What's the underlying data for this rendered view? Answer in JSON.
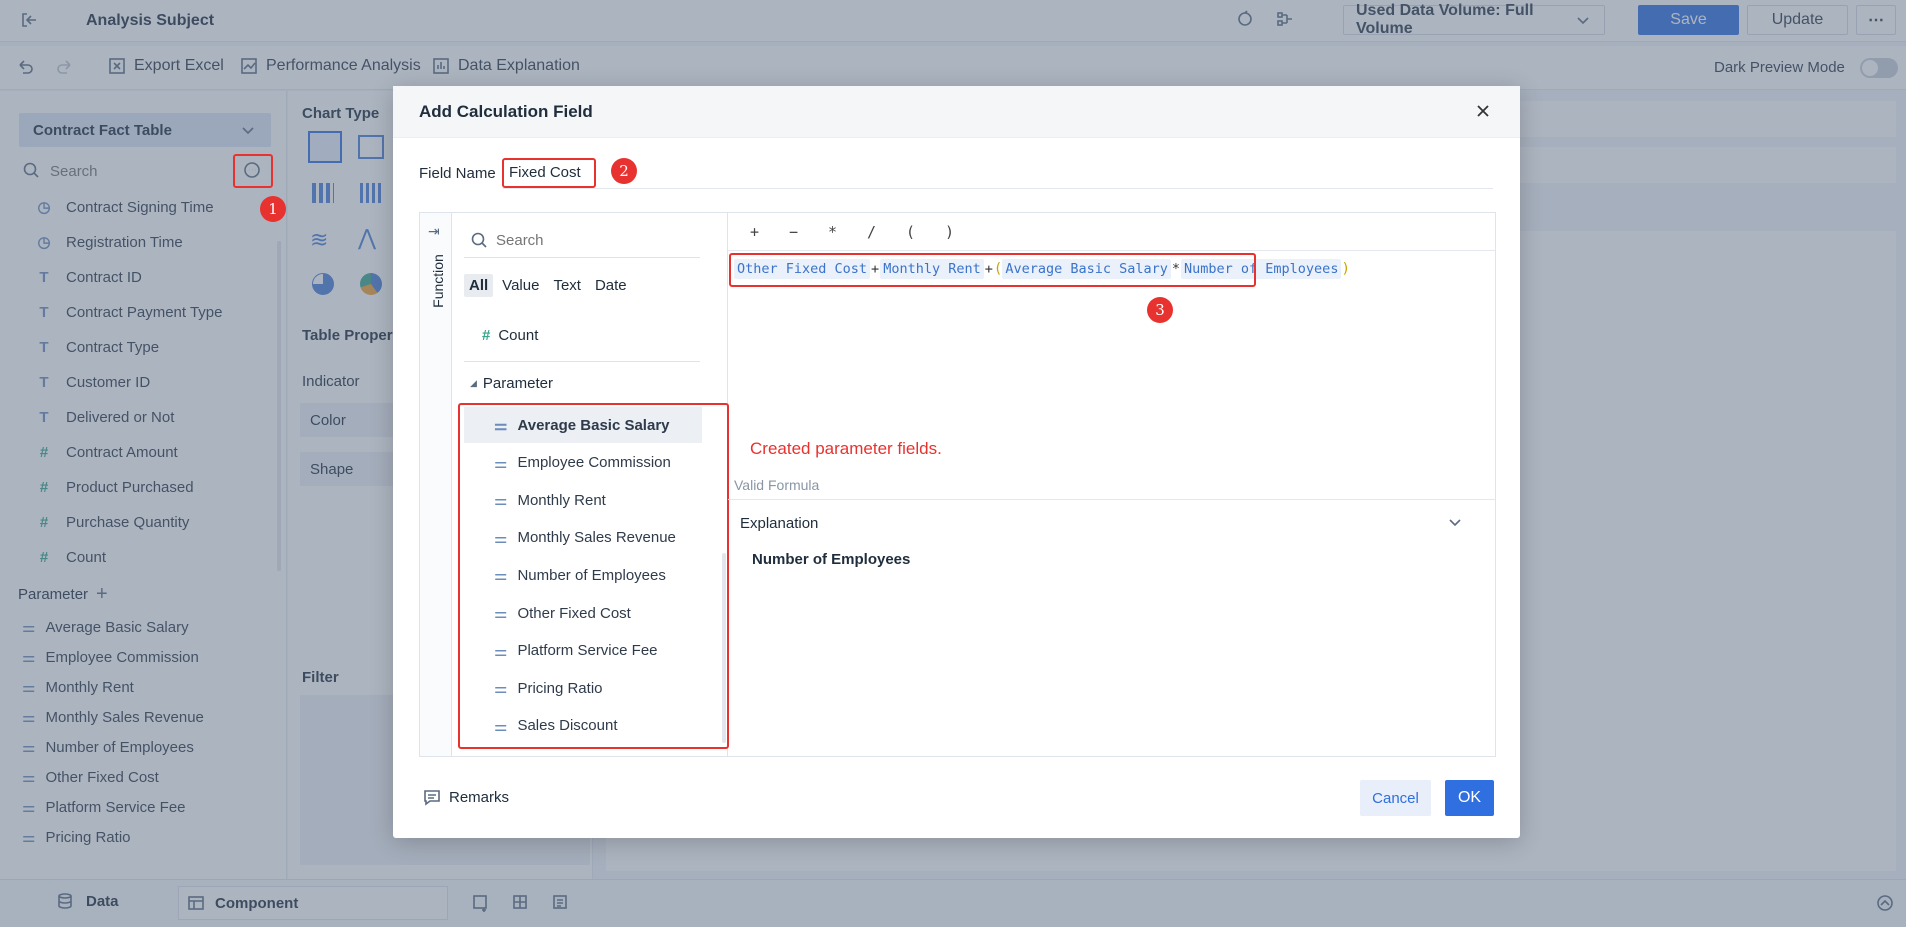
{
  "topbar": {
    "title": "Analysis Subject",
    "data_volume": "Used Data Volume: Full Volume",
    "save_label": "Save",
    "update_label": "Update"
  },
  "toolbar": {
    "export_excel": "Export Excel",
    "performance_analysis": "Performance Analysis",
    "data_explanation": "Data Explanation",
    "dark_preview": "Dark Preview Mode"
  },
  "sidebar": {
    "table_name": "Contract Fact Table",
    "search_placeholder": "Search",
    "fields": [
      {
        "label": "Contract Signing Time",
        "type": "clock"
      },
      {
        "label": "Registration Time",
        "type": "clock"
      },
      {
        "label": "Contract ID",
        "type": "T"
      },
      {
        "label": "Contract Payment Type",
        "type": "T"
      },
      {
        "label": "Contract Type",
        "type": "T"
      },
      {
        "label": "Customer ID",
        "type": "T"
      },
      {
        "label": "Delivered or Not",
        "type": "T"
      },
      {
        "label": "Contract Amount",
        "type": "#"
      },
      {
        "label": "Product Purchased",
        "type": "#"
      },
      {
        "label": "Purchase Quantity",
        "type": "#"
      },
      {
        "label": "Count",
        "type": "#"
      }
    ],
    "parameter_title": "Parameter",
    "parameters": [
      "Average Basic Salary",
      "Employee Commission",
      "Monthly Rent",
      "Monthly Sales Revenue",
      "Number of Employees",
      "Other Fixed Cost",
      "Platform Service Fee",
      "Pricing Ratio"
    ]
  },
  "midpanel": {
    "chart_type": "Chart Type",
    "table_properties": "Table Proper",
    "indicator": "Indicator",
    "color": "Color",
    "shape": "Shape",
    "filter": "Filter"
  },
  "bottombar": {
    "data_tab": "Data",
    "component_tab": "Component"
  },
  "modal": {
    "title": "Add Calculation Field",
    "field_name_label": "Field Name",
    "field_name_value": "Fixed Cost",
    "function_tab": "Function",
    "search_placeholder": "Search",
    "filters": [
      "All",
      "Value",
      "Text",
      "Date"
    ],
    "count_item": "Count",
    "parameter_group": "Parameter",
    "parameter_items": [
      "Average Basic Salary",
      "Employee Commission",
      "Monthly Rent",
      "Monthly Sales Revenue",
      "Number of Employees",
      "Other Fixed Cost",
      "Platform Service Fee",
      "Pricing Ratio",
      "Sales Discount"
    ],
    "operators": [
      "+",
      "−",
      "*",
      "/",
      "(",
      ")"
    ],
    "formula": {
      "t1": "Other Fixed Cost",
      "op1": "+",
      "t2": "Monthly Rent",
      "op2": "+",
      "open": "(",
      "t3": "Average Basic Salary",
      "op3": "*",
      "t4": "Number of Employees",
      "close": ")"
    },
    "annotation": "Created parameter fields.",
    "valid_formula": "Valid Formula",
    "explanation_label": "Explanation",
    "explanation_text": "Number of Employees",
    "remarks": "Remarks",
    "cancel": "Cancel",
    "ok": "OK"
  },
  "badges": [
    "1",
    "2",
    "3"
  ]
}
